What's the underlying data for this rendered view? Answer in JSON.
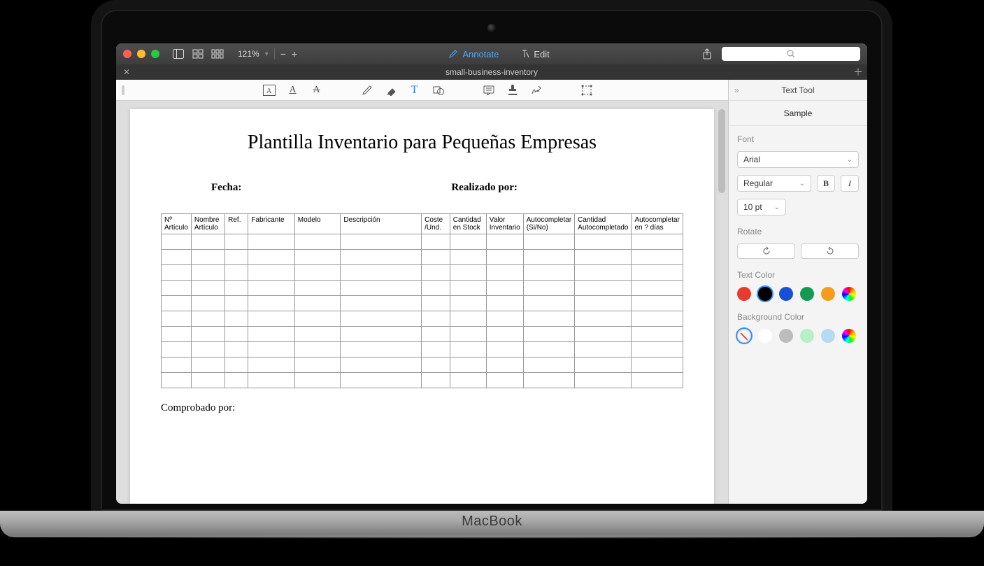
{
  "titlebar": {
    "zoom_level": "121%",
    "mode_annotate": "Annotate",
    "mode_edit": "Edit"
  },
  "tab": {
    "title": "small-business-inventory"
  },
  "document": {
    "title": "Plantilla Inventario para Pequeñas Empresas",
    "fecha_label": "Fecha:",
    "realizado_label": "Realizado por:",
    "comprobado_label": "Comprobado por:",
    "columns": [
      "Nº Artículo",
      "Nombre Artículo",
      "Ref.",
      "Fabricante",
      "Modelo",
      "Descripción",
      "Coste /Und.",
      "Cantidad en Stock",
      "Valor Inventario",
      "Autocompletar (Si/No)",
      "Cantidad Autocompletado",
      "Autocompletar en ? días"
    ],
    "row_count": 10
  },
  "sidebar": {
    "title": "Text Tool",
    "sample_text": "Sample",
    "font_label": "Font",
    "font_family": "Arial",
    "font_style": "Regular",
    "font_size": "10 pt",
    "bold_label": "B",
    "italic_label": "I",
    "rotate_label": "Rotate",
    "text_color_label": "Text Color",
    "bg_color_label": "Background Color",
    "text_colors": [
      "#e83a2f",
      "#000000",
      "#1650d4",
      "#159a52",
      "#f59c1f"
    ],
    "text_color_selected": 1,
    "bg_colors": [
      "none",
      "#ffffff",
      "#bcbcbc",
      "#b8f0c6",
      "#b6d9f5"
    ]
  }
}
